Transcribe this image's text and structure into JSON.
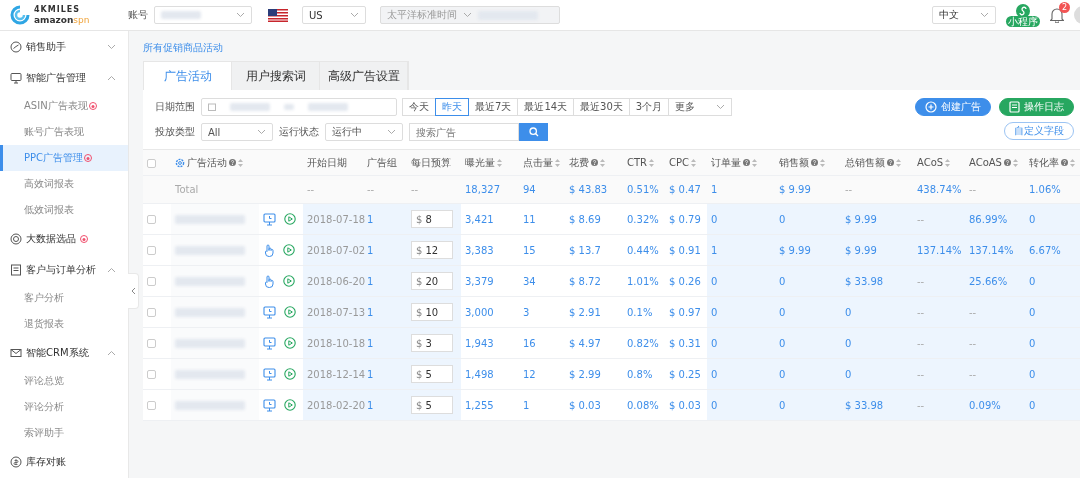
{
  "topbar": {
    "logo": {
      "brand": "4KMILES",
      "wordmark": "amazon",
      "suffix": "spn"
    },
    "account_label": "账号",
    "region": "US",
    "timezone": {
      "value": "太平洋标准时间",
      "disabled": true
    },
    "language": "中文",
    "mini_program": "小程序",
    "notifications": "2"
  },
  "sidebar": {
    "items": [
      {
        "label": "销售助手",
        "kind": "group",
        "expanded": false,
        "badge": false,
        "selected": false
      },
      {
        "label": "智能广告管理",
        "kind": "group",
        "expanded": true,
        "badge": false,
        "selected": false,
        "children": [
          {
            "label": "ASIN广告表现",
            "badge": true,
            "selected": false
          },
          {
            "label": "账号广告表现",
            "badge": false,
            "selected": false
          },
          {
            "label": "PPC广告管理",
            "badge": true,
            "selected": true
          },
          {
            "label": "高效词报表",
            "badge": false,
            "selected": false
          },
          {
            "label": "低效词报表",
            "badge": false,
            "selected": false
          }
        ]
      },
      {
        "label": "大数据选品",
        "kind": "link",
        "badge": true,
        "selected": false
      },
      {
        "label": "客户与订单分析",
        "kind": "group",
        "expanded": true,
        "badge": false,
        "selected": false,
        "children": [
          {
            "label": "客户分析",
            "badge": false,
            "selected": false
          },
          {
            "label": "退货报表",
            "badge": false,
            "selected": false
          }
        ]
      },
      {
        "label": "智能CRM系统",
        "kind": "group",
        "expanded": true,
        "badge": false,
        "selected": false,
        "children": [
          {
            "label": "评论总览",
            "badge": false,
            "selected": false
          },
          {
            "label": "评论分析",
            "badge": false,
            "selected": false
          },
          {
            "label": "索评助手",
            "badge": false,
            "selected": false
          }
        ]
      },
      {
        "label": "库存对账",
        "kind": "link",
        "badge": false,
        "selected": false
      }
    ]
  },
  "breadcrumb": "所有促销商品活动",
  "tabs": [
    {
      "label": "广告活动",
      "selected": true
    },
    {
      "label": "用户搜索词",
      "selected": false
    },
    {
      "label": "高级广告设置",
      "selected": false
    }
  ],
  "filters": {
    "date_label": "日期范围",
    "quick_ranges": [
      {
        "label": "今天",
        "selected": false
      },
      {
        "label": "昨天",
        "selected": true
      },
      {
        "label": "最近7天",
        "selected": false
      },
      {
        "label": "最近14天",
        "selected": false
      },
      {
        "label": "最近30天",
        "selected": false
      },
      {
        "label": "3个月",
        "selected": false
      }
    ],
    "more": "更多",
    "type_label": "投放类型",
    "type_value": "All",
    "status_label": "运行状态",
    "status_value": "运行中",
    "search_placeholder": "搜索广告"
  },
  "actions": [
    {
      "label": "创建广告",
      "kind": "primary"
    },
    {
      "label": "操作日志",
      "kind": "success"
    },
    {
      "label": "自定义字段",
      "kind": "outline"
    }
  ],
  "table": {
    "all_checked": false,
    "columns": [
      {
        "label": "广告活动",
        "help": true,
        "sortable": true
      },
      {
        "label": "开始日期",
        "help": false,
        "sortable": false
      },
      {
        "label": "广告组",
        "help": false,
        "sortable": false
      },
      {
        "label": "每日预算",
        "help": false,
        "sortable": false
      },
      {
        "label": "曝光量",
        "help": false,
        "sortable": true
      },
      {
        "label": "点击量",
        "help": false,
        "sortable": true
      },
      {
        "label": "花费",
        "help": true,
        "sortable": true
      },
      {
        "label": "CTR",
        "help": false,
        "sortable": true
      },
      {
        "label": "CPC",
        "help": false,
        "sortable": true
      },
      {
        "label": "订单量",
        "help": true,
        "sortable": true
      },
      {
        "label": "销售额",
        "help": true,
        "sortable": true
      },
      {
        "label": "总销售额",
        "help": true,
        "sortable": true
      },
      {
        "label": "ACoS",
        "help": false,
        "sortable": true
      },
      {
        "label": "ACoAS",
        "help": true,
        "sortable": true
      },
      {
        "label": "转化率",
        "help": true,
        "sortable": true
      }
    ],
    "total": {
      "campaign": "Total",
      "start_date": "--",
      "ad_groups": "--",
      "daily_budget": "--",
      "impressions": "18,327",
      "clicks": "94",
      "spend": "$ 43.83",
      "ctr": "0.51%",
      "cpc": "$ 0.47",
      "orders": "1",
      "sales": "$ 9.99",
      "total_sales": "--",
      "acos": "438.74%",
      "acoas": "--",
      "conversion_rate": "1.06%"
    },
    "rows": [
      {
        "checked": false,
        "kind": "screen",
        "start_date": "2018-07-18",
        "ad_groups": "1",
        "currency": "$",
        "daily_budget": "8",
        "impressions": "3,421",
        "clicks": "11",
        "spend": "$ 8.69",
        "ctr": "0.32%",
        "cpc": "$ 0.79",
        "orders": "0",
        "sales": "0",
        "total_sales": "$ 9.99",
        "acos": "--",
        "acoas": "86.99%",
        "conversion_rate": "0"
      },
      {
        "checked": false,
        "kind": "hand",
        "start_date": "2018-07-02",
        "ad_groups": "1",
        "currency": "$",
        "daily_budget": "12",
        "impressions": "3,383",
        "clicks": "15",
        "spend": "$ 13.7",
        "ctr": "0.44%",
        "cpc": "$ 0.91",
        "orders": "1",
        "sales": "$ 9.99",
        "total_sales": "$ 9.99",
        "acos": "137.14%",
        "acoas": "137.14%",
        "conversion_rate": "6.67%"
      },
      {
        "checked": false,
        "kind": "hand",
        "start_date": "2018-06-20",
        "ad_groups": "1",
        "currency": "$",
        "daily_budget": "20",
        "impressions": "3,379",
        "clicks": "34",
        "spend": "$ 8.72",
        "ctr": "1.01%",
        "cpc": "$ 0.26",
        "orders": "0",
        "sales": "0",
        "total_sales": "$ 33.98",
        "acos": "--",
        "acoas": "25.66%",
        "conversion_rate": "0"
      },
      {
        "checked": false,
        "kind": "screen",
        "start_date": "2018-07-13",
        "ad_groups": "1",
        "currency": "$",
        "daily_budget": "10",
        "impressions": "3,000",
        "clicks": "3",
        "spend": "$ 2.91",
        "ctr": "0.1%",
        "cpc": "$ 0.97",
        "orders": "0",
        "sales": "0",
        "total_sales": "0",
        "acos": "--",
        "acoas": "--",
        "conversion_rate": "0"
      },
      {
        "checked": false,
        "kind": "screen",
        "start_date": "2018-10-18",
        "ad_groups": "1",
        "currency": "$",
        "daily_budget": "3",
        "impressions": "1,943",
        "clicks": "16",
        "spend": "$ 4.97",
        "ctr": "0.82%",
        "cpc": "$ 0.31",
        "orders": "0",
        "sales": "0",
        "total_sales": "0",
        "acos": "--",
        "acoas": "--",
        "conversion_rate": "0"
      },
      {
        "checked": false,
        "kind": "screen",
        "start_date": "2018-12-14",
        "ad_groups": "1",
        "currency": "$",
        "daily_budget": "5",
        "impressions": "1,498",
        "clicks": "12",
        "spend": "$ 2.99",
        "ctr": "0.8%",
        "cpc": "$ 0.25",
        "orders": "0",
        "sales": "0",
        "total_sales": "0",
        "acos": "--",
        "acoas": "--",
        "conversion_rate": "0"
      },
      {
        "checked": false,
        "kind": "screen",
        "start_date": "2018-02-20",
        "ad_groups": "1",
        "currency": "$",
        "daily_budget": "5",
        "impressions": "1,255",
        "clicks": "1",
        "spend": "$ 0.03",
        "ctr": "0.08%",
        "cpc": "$ 0.03",
        "orders": "0",
        "sales": "0",
        "total_sales": "$ 33.98",
        "acos": "--",
        "acoas": "0.09%",
        "conversion_rate": "0"
      }
    ]
  }
}
